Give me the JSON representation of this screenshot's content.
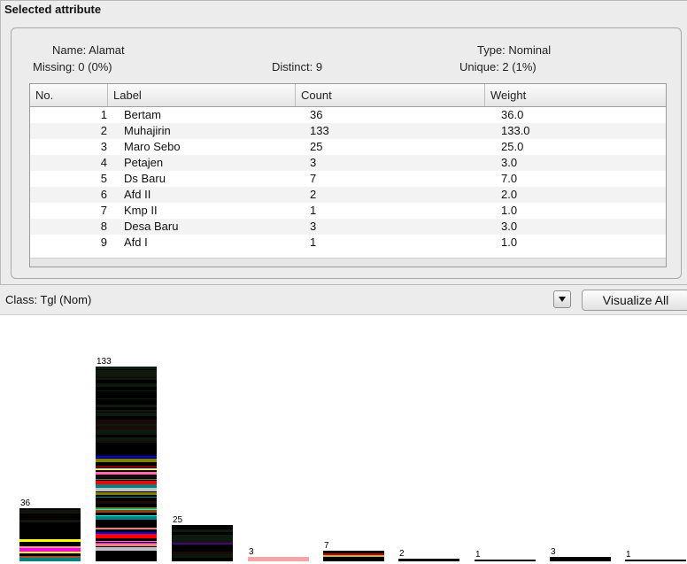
{
  "panel": {
    "title": "Selected attribute",
    "name": "Name: Alamat",
    "missing": "Missing: 0 (0%)",
    "distinct": "Distinct: 9",
    "type": "Type: Nominal",
    "unique": "Unique: 2 (1%)"
  },
  "table": {
    "headers": [
      "No.",
      "Label",
      "Count",
      "Weight"
    ],
    "rows": [
      {
        "no": "1",
        "label": "Bertam",
        "count": "36",
        "weight": "36.0"
      },
      {
        "no": "2",
        "label": "Muhajirin",
        "count": "133",
        "weight": "133.0"
      },
      {
        "no": "3",
        "label": "Maro Sebo",
        "count": "25",
        "weight": "25.0"
      },
      {
        "no": "4",
        "label": "Petajen",
        "count": "3",
        "weight": "3.0"
      },
      {
        "no": "5",
        "label": "Ds Baru",
        "count": "7",
        "weight": "7.0"
      },
      {
        "no": "6",
        "label": "Afd II",
        "count": "2",
        "weight": "2.0"
      },
      {
        "no": "7",
        "label": "Kmp II",
        "count": "1",
        "weight": "1.0"
      },
      {
        "no": "8",
        "label": "Desa Baru",
        "count": "3",
        "weight": "3.0"
      },
      {
        "no": "9",
        "label": "Afd I",
        "count": "1",
        "weight": "1.0"
      }
    ]
  },
  "classbar": {
    "class_label": "Class: Tgl (Nom)",
    "visualize_label": "Visualize All"
  },
  "chart_data": {
    "type": "bar",
    "categories": [
      "Bertam",
      "Muhajirin",
      "Maro Sebo",
      "Petajen",
      "Ds Baru",
      "Afd II",
      "Kmp II",
      "Desa Baru",
      "Afd I"
    ],
    "values": [
      36,
      133,
      25,
      3,
      7,
      2,
      1,
      3,
      1
    ],
    "data_labels": [
      "36",
      "133",
      "25",
      "3",
      "7",
      "2",
      "1",
      "3",
      "1"
    ],
    "ylim": [
      0,
      133
    ],
    "stacked_by_class": true,
    "class_colors": [
      "#000000",
      "#0a1a0a",
      "#1a0a0a",
      "#0000ff",
      "#ff0000",
      "#00a000",
      "#ff00ff",
      "#00ffff",
      "#ffff00",
      "#ff69b4",
      "#8b4513",
      "#808000",
      "#4b0082",
      "#ffa07a",
      "#2e8b57",
      "#a0522d",
      "#c0c0c0",
      "#800000",
      "#008080",
      "#f08080"
    ]
  }
}
